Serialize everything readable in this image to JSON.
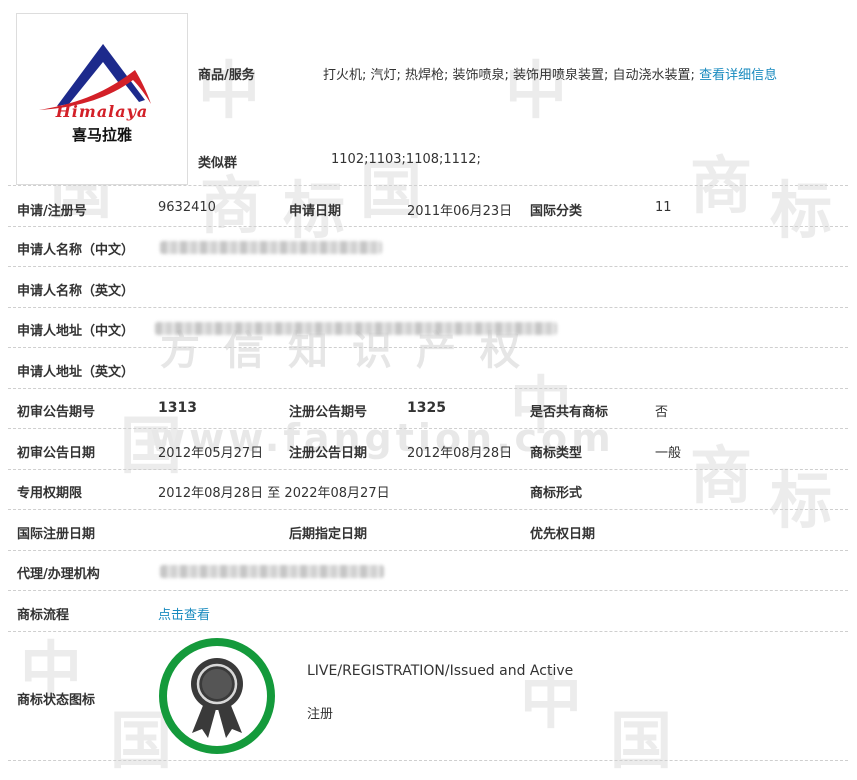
{
  "logo": {
    "brand_latin": "Himalaya",
    "brand_chinese": "喜马拉雅",
    "accent_blue": "#1d2a8c",
    "accent_red": "#d32028"
  },
  "watermark": {
    "text": "方信知识产权",
    "url": "www.fangtion.com",
    "chars": [
      "中",
      "国",
      "商",
      "标"
    ]
  },
  "goods": {
    "label": "商品/服务",
    "value": "打火机; 汽灯; 热焊枪; 装饰喷泉; 装饰用喷泉装置; 自动浇水装置;",
    "link": "查看详细信息"
  },
  "similar_group": {
    "label": "类似群",
    "value": "1102;1103;1108;1112;"
  },
  "registration": {
    "no_label": "申请/注册号",
    "no_value": "9632410",
    "date_label": "申请日期",
    "date_value": "2011年06月23日",
    "class_label": "国际分类",
    "class_value": "11"
  },
  "applicant": {
    "name_cn_label": "申请人名称（中文）",
    "name_en_label": "申请人名称（英文）",
    "addr_cn_label": "申请人地址（中文）",
    "addr_en_label": "申请人地址（英文）"
  },
  "announcement": {
    "prelim_no_label": "初审公告期号",
    "prelim_no_value": "1313",
    "reg_no_label": "注册公告期号",
    "reg_no_value": "1325",
    "shared_label": "是否共有商标",
    "shared_value": "否",
    "prelim_date_label": "初审公告日期",
    "prelim_date_value": "2012年05月27日",
    "reg_date_label": "注册公告日期",
    "reg_date_value": "2012年08月28日",
    "type_label": "商标类型",
    "type_value": "一般"
  },
  "rights": {
    "term_label": "专用权期限",
    "term_value": "2012年08月28日 至 2022年08月27日",
    "form_label": "商标形式"
  },
  "intl": {
    "reg_date_label": "国际注册日期",
    "later_label": "后期指定日期",
    "priority_label": "优先权日期"
  },
  "agent": {
    "label": "代理/办理机构"
  },
  "flow": {
    "label": "商标流程",
    "link": "点击查看"
  },
  "status": {
    "label": "商标状态图标",
    "line1": "LIVE/REGISTRATION/Issued and Active",
    "line2": "注册",
    "ring_color": "#149a3b"
  }
}
